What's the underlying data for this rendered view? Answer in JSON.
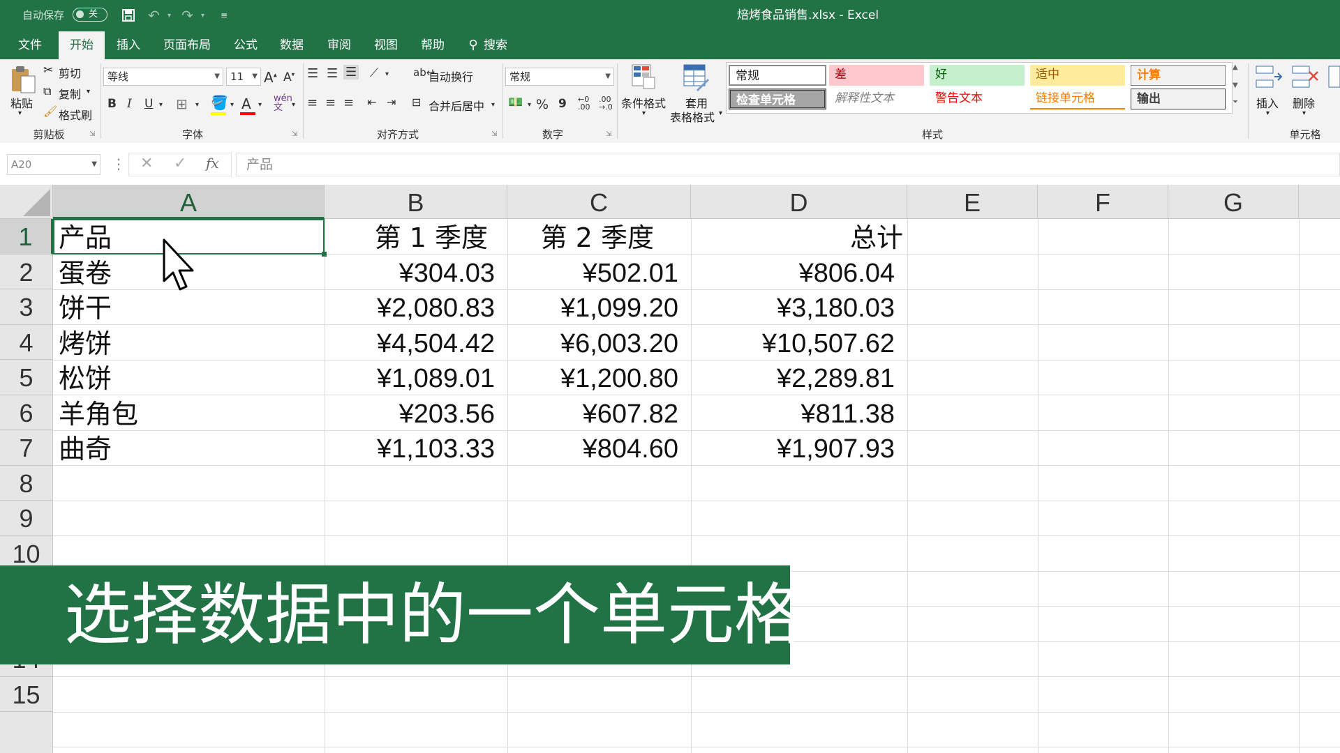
{
  "titlebar": {
    "autosave_label": "自动保存",
    "autosave_state": "关",
    "title": "焙烤食品销售.xlsx  -  Excel"
  },
  "tabs": [
    {
      "label": "文件"
    },
    {
      "label": "开始"
    },
    {
      "label": "插入"
    },
    {
      "label": "页面布局"
    },
    {
      "label": "公式"
    },
    {
      "label": "数据"
    },
    {
      "label": "审阅"
    },
    {
      "label": "视图"
    },
    {
      "label": "帮助"
    },
    {
      "label": "搜索"
    }
  ],
  "ribbon": {
    "clipboard": {
      "paste": "粘贴",
      "cut": "剪切",
      "copy": "复制",
      "format_painter": "格式刷",
      "group": "剪贴板"
    },
    "font": {
      "name": "等线",
      "size": "11",
      "bold": "B",
      "italic": "I",
      "underline": "U",
      "group": "字体"
    },
    "alignment": {
      "wrap": "自动换行",
      "merge": "合并后居中",
      "group": "对齐方式"
    },
    "number": {
      "format": "常规",
      "percent": "%",
      "comma": "9",
      "group": "数字"
    },
    "styles": {
      "conditional": "条件格式",
      "table_format_1": "套用",
      "table_format_2": "表格格式",
      "group": "样式",
      "cells": [
        "常规",
        "差",
        "好",
        "适中",
        "计算",
        "检查单元格",
        "解释性文本",
        "警告文本",
        "链接单元格",
        "输出"
      ]
    },
    "cells": {
      "insert": "插入",
      "delete": "删除",
      "group": "单元格"
    }
  },
  "formula_bar": {
    "name_box": "A20",
    "fx": "fx",
    "content": "产品"
  },
  "columns": [
    "A",
    "B",
    "C",
    "D",
    "E",
    "F",
    "G"
  ],
  "rows": [
    "1",
    "2",
    "3",
    "4",
    "5",
    "6",
    "7",
    "8",
    "9",
    "10",
    "14",
    "15"
  ],
  "table": {
    "headers": [
      "产品",
      "第 1 季度",
      "第 2 季度",
      "总计"
    ],
    "rows": [
      [
        "蛋卷",
        "¥304.03",
        "¥502.01",
        "¥806.04"
      ],
      [
        "饼干",
        "¥2,080.83",
        "¥1,099.20",
        "¥3,180.03"
      ],
      [
        "烤饼",
        "¥4,504.42",
        "¥6,003.20",
        "¥10,507.62"
      ],
      [
        "松饼",
        "¥1,089.01",
        "¥1,200.80",
        "¥2,289.81"
      ],
      [
        "羊角包",
        "¥203.56",
        "¥607.82",
        "¥811.38"
      ],
      [
        "曲奇",
        "¥1,103.33",
        "¥804.60",
        "¥1,907.93"
      ]
    ]
  },
  "caption": "选择数据中的一个单元格",
  "colors": {
    "brand": "#217346",
    "bad": "#ffc7ce",
    "good": "#c6efce",
    "neutral": "#ffeb9c"
  }
}
